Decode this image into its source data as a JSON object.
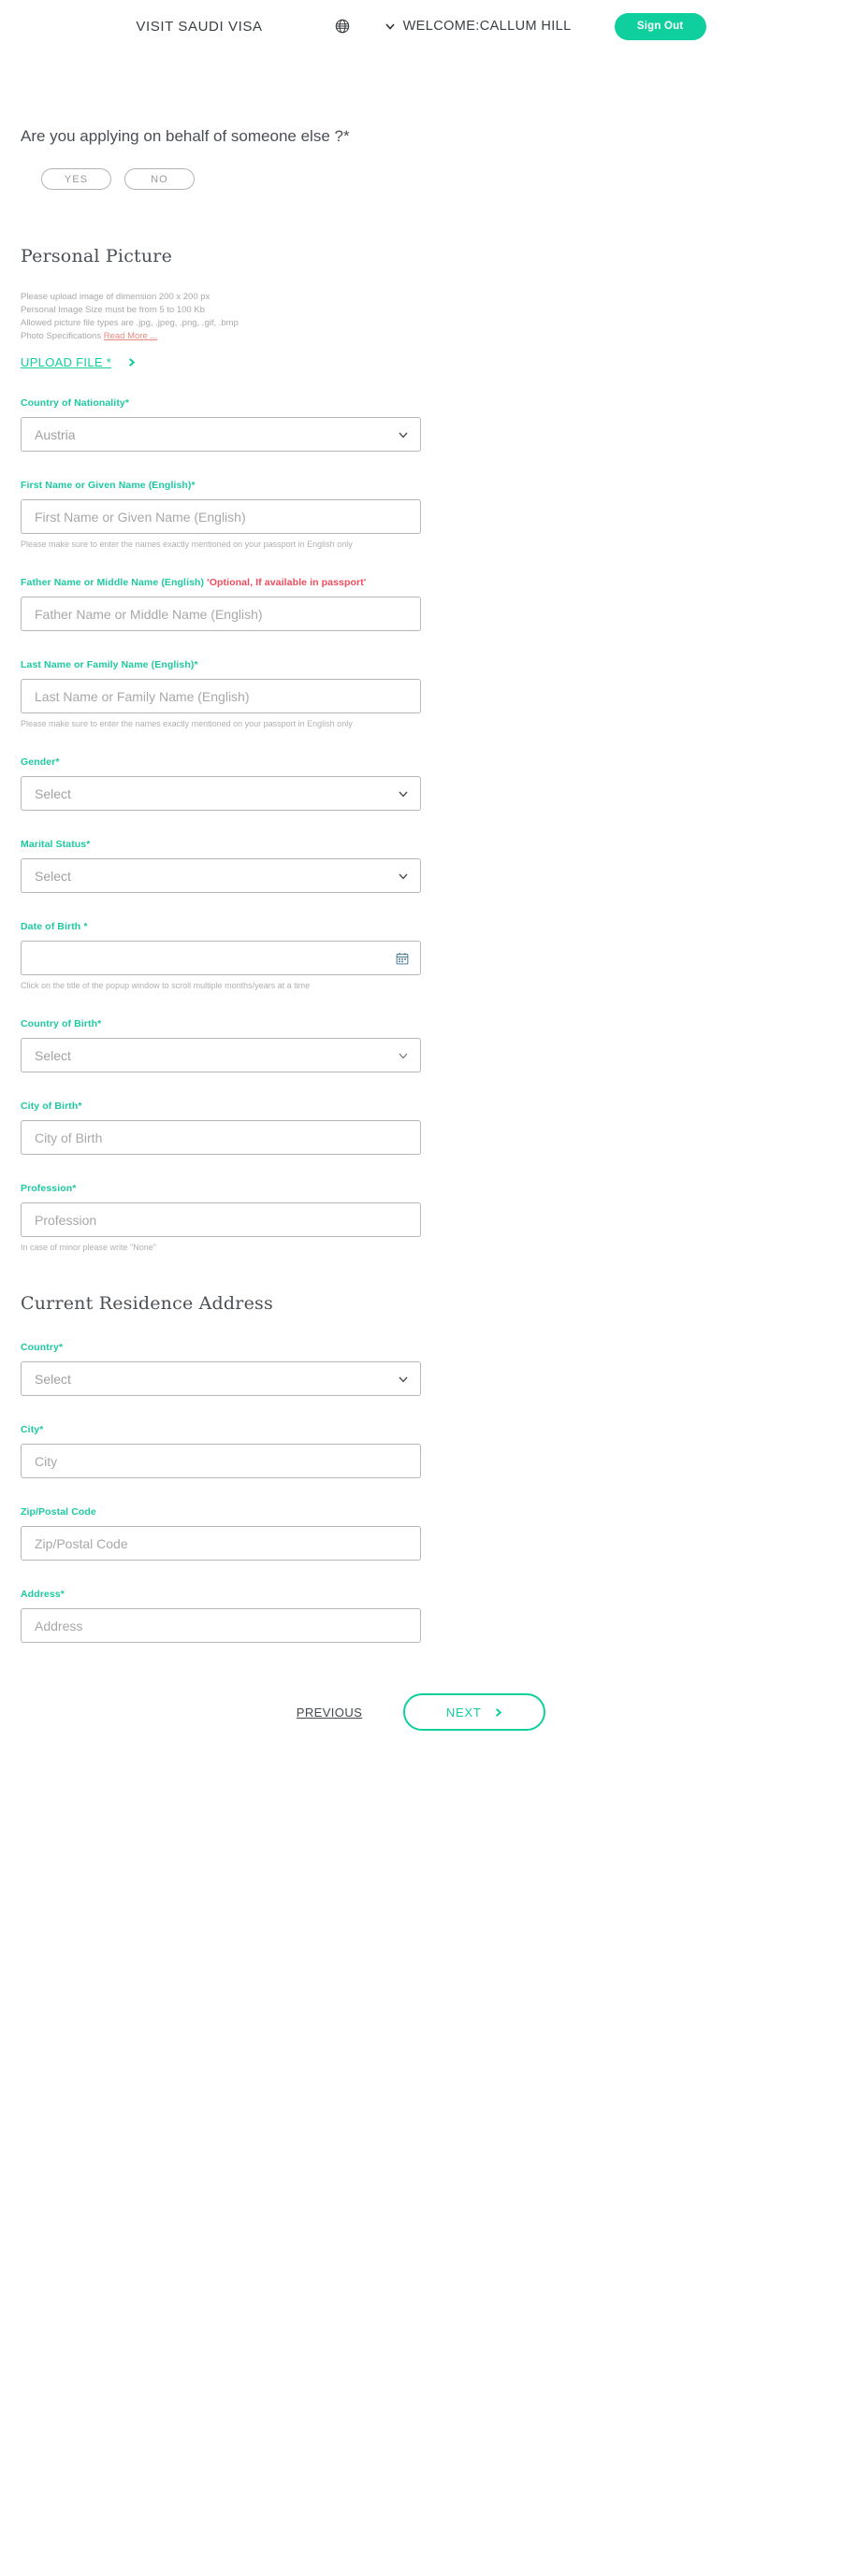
{
  "header": {
    "brand": "VISIT SAUDI VISA",
    "globe_icon": "globe-icon",
    "chevron_icon": "chevron-down-icon",
    "welcome": "WELCOME:CALLUM HILL",
    "sign_out": "Sign Out",
    "accent_color": "#0fcf9e"
  },
  "behalf": {
    "question": "Are you applying on behalf of someone else ?*",
    "yes": "YES",
    "no": "NO"
  },
  "personal_picture": {
    "title": "Personal Picture",
    "hint1": "Please upload image of dimension 200 x 200 px",
    "hint2": "Personal Image Size must be from 5 to 100 Kb",
    "hint3": "Allowed picture file types are .jpg, .jpeg, .png, .gif, .bmp",
    "hint4_prefix": "Photo Specifications ",
    "read_more": "Read More ...",
    "upload_label": "UPLOAD FILE *",
    "upload_arrow_icon": "chevron-right-icon"
  },
  "fields": {
    "nationality": {
      "label": "Country of Nationality*",
      "value": "Austria",
      "caret_icon": "chevron-down-icon"
    },
    "first_name": {
      "label": "First Name or Given Name (English)*",
      "placeholder": "First Name or Given Name (English)",
      "helper": "Please make sure to enter the names exactly mentioned on your passport in English only"
    },
    "father_name": {
      "label_main": "Father Name or Middle Name (English) ",
      "label_optional": "'Optional, If available in passport'",
      "placeholder": "Father Name or Middle Name (English)"
    },
    "last_name": {
      "label": "Last Name or Family Name (English)*",
      "placeholder": "Last Name or Family Name (English)",
      "helper": "Please make sure to enter the names exactly mentioned on your passport in English only"
    },
    "gender": {
      "label": "Gender*",
      "value": "Select",
      "caret_icon": "chevron-down-icon"
    },
    "marital_status": {
      "label": "Marital Status*",
      "value": "Select",
      "caret_icon": "chevron-down-icon"
    },
    "date_of_birth": {
      "label": "Date of Birth *",
      "value": "",
      "calendar_icon": "calendar-icon",
      "helper": "Click on the title of the popup window to scroll multiple months/years at a time"
    },
    "country_of_birth": {
      "label": "Country of Birth*",
      "value": "Select",
      "caret_icon": "chevron-down-icon"
    },
    "city_of_birth": {
      "label": "City of Birth*",
      "placeholder": "City of Birth"
    },
    "profession": {
      "label": "Profession*",
      "placeholder": "Profession",
      "helper": "In case of minor please write \"None\""
    }
  },
  "residence": {
    "title": "Current Residence Address",
    "country": {
      "label": "Country*",
      "value": "Select",
      "caret_icon": "chevron-down-icon"
    },
    "city": {
      "label": "City*",
      "placeholder": "City"
    },
    "zip": {
      "label": "Zip/Postal Code",
      "placeholder": "Zip/Postal Code"
    },
    "address": {
      "label": "Address*",
      "placeholder": "Address"
    }
  },
  "footer": {
    "previous": "PREVIOUS",
    "next": "NEXT",
    "next_arrow_icon": "chevron-right-icon"
  }
}
